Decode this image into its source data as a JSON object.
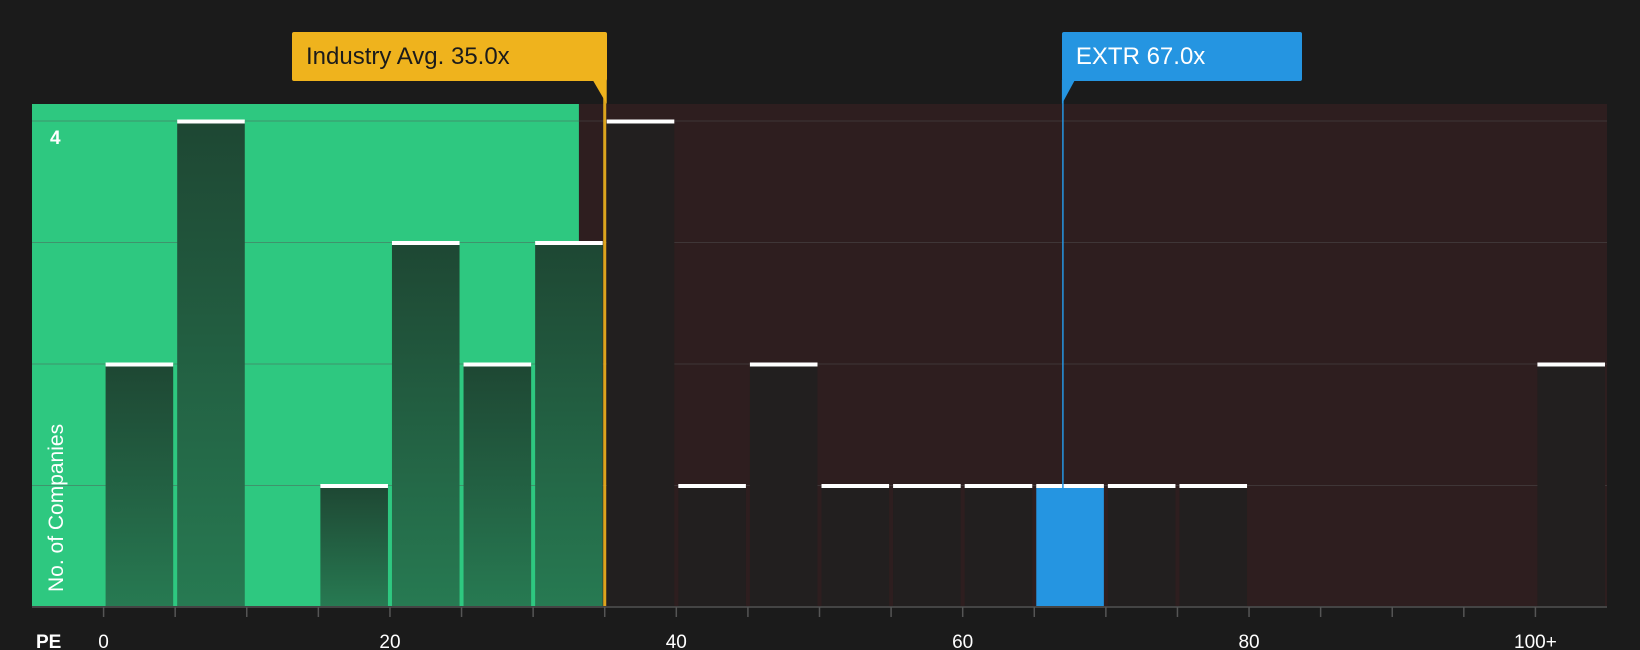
{
  "chart_data": {
    "type": "bar",
    "title": "",
    "xlabel": "PE",
    "ylabel": "No. of Companies",
    "xlim": [
      -5,
      105
    ],
    "ylim": [
      0,
      4
    ],
    "x_ticks": [
      0,
      20,
      40,
      60,
      80
    ],
    "x_tick_labels": [
      "0",
      "20",
      "40",
      "60",
      "80",
      "100+"
    ],
    "y_tick_labels": [
      "4"
    ],
    "bin_width": 5,
    "bins": [
      {
        "x0": 0,
        "x1": 5,
        "count": 2
      },
      {
        "x0": 5,
        "x1": 10,
        "count": 4
      },
      {
        "x0": 10,
        "x1": 15,
        "count": 0
      },
      {
        "x0": 15,
        "x1": 20,
        "count": 1
      },
      {
        "x0": 20,
        "x1": 25,
        "count": 3
      },
      {
        "x0": 25,
        "x1": 30,
        "count": 2
      },
      {
        "x0": 30,
        "x1": 35,
        "count": 3
      },
      {
        "x0": 35,
        "x1": 40,
        "count": 4
      },
      {
        "x0": 40,
        "x1": 45,
        "count": 1
      },
      {
        "x0": 45,
        "x1": 50,
        "count": 2
      },
      {
        "x0": 50,
        "x1": 55,
        "count": 1
      },
      {
        "x0": 55,
        "x1": 60,
        "count": 1
      },
      {
        "x0": 60,
        "x1": 65,
        "count": 1
      },
      {
        "x0": 65,
        "x1": 70,
        "count": 1
      },
      {
        "x0": 70,
        "x1": 75,
        "count": 1
      },
      {
        "x0": 75,
        "x1": 80,
        "count": 1
      },
      {
        "x0": 80,
        "x1": 85,
        "count": 0
      },
      {
        "x0": 85,
        "x1": 90,
        "count": 0
      },
      {
        "x0": 90,
        "x1": 95,
        "count": 0
      },
      {
        "x0": 95,
        "x1": 100,
        "count": 0
      },
      {
        "x0": 100,
        "x1": 105,
        "count": 2
      }
    ],
    "highlight_bin_index": 13,
    "industry_avg": 35.0,
    "company_value": 67.0,
    "grid": true,
    "colors": {
      "background": "#1b1b1b",
      "below_avg_zone": "#2ec880",
      "above_avg_zone": "#2e1e1f",
      "bar_in_zone": "#23573b",
      "bar_default": "#221f1f",
      "bar_highlight": "#2595e1",
      "bar_cap": "#ffffff",
      "industry_line": "#efb31d",
      "company_line": "#2595e1",
      "gridline": "#555555",
      "text": "#ffffff"
    }
  },
  "callouts": {
    "industry_label": "Industry Avg. 35.0x",
    "company_label": "EXTR 67.0x"
  }
}
